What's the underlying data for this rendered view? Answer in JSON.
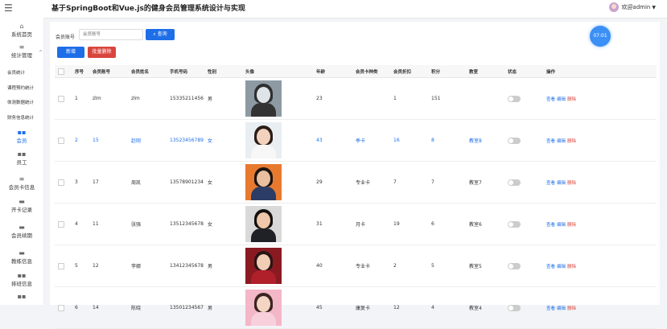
{
  "header": {
    "title": "基于SpringBoot和Vue.js的健身会员管理系统设计与实现",
    "user": "欢迎admin"
  },
  "sidebar": {
    "items": [
      {
        "label": "系统首页",
        "icon": "home-icon"
      },
      {
        "label": "统计管理",
        "icon": "menu-icon"
      },
      {
        "label": "会员",
        "icon": "grid-icon",
        "active": true
      },
      {
        "label": "员工",
        "icon": "grid-icon"
      },
      {
        "label": "会员卡信息",
        "icon": "menu-icon"
      },
      {
        "label": "开卡记录",
        "icon": "card-icon"
      },
      {
        "label": "会员续期",
        "icon": "card-icon"
      },
      {
        "label": "教练信息",
        "icon": "card-icon"
      },
      {
        "label": "排班信息",
        "icon": "grid-icon"
      }
    ],
    "sub_items": [
      "会员统计",
      "课程预约统计",
      "体测数据统计",
      "财务信息统计"
    ]
  },
  "search": {
    "label": "会员账号",
    "placeholder": "会员账号",
    "button": "查询"
  },
  "actions": {
    "add": "新增",
    "batch_delete": "批量删除"
  },
  "clock": "07:01",
  "table": {
    "columns": [
      "序号",
      "会员账号",
      "会员姓名",
      "手机号码",
      "性别",
      "头像",
      "年龄",
      "会员卡种类",
      "会员折扣",
      "积分",
      "教室",
      "状态",
      "操作"
    ],
    "row_actions": {
      "view": "查看",
      "edit": "编辑",
      "delete": "删除"
    },
    "rows": [
      {
        "no": "1",
        "account": "zlm",
        "name": "zlm",
        "phone": "15335211456",
        "gender": "男",
        "age": "23",
        "card": "",
        "discount": "1",
        "points": "151",
        "room": "",
        "photo": "cartoon"
      },
      {
        "no": "2",
        "account": "15",
        "name": "赵刚",
        "phone": "13523456789",
        "gender": "女",
        "age": "43",
        "card": "季卡",
        "discount": "16",
        "points": "8",
        "room": "教室8",
        "photo": "woman-white",
        "highlight": true
      },
      {
        "no": "3",
        "account": "17",
        "name": "周凯",
        "phone": "13578901234",
        "gender": "女",
        "age": "29",
        "card": "专业卡",
        "discount": "7",
        "points": "7",
        "room": "教室7",
        "photo": "man-orange"
      },
      {
        "no": "4",
        "account": "11",
        "name": "张强",
        "phone": "13512345678",
        "gender": "女",
        "age": "31",
        "card": "月卡",
        "discount": "19",
        "points": "6",
        "room": "教室6",
        "photo": "man-suit"
      },
      {
        "no": "5",
        "account": "12",
        "name": "李娜",
        "phone": "13412345678",
        "gender": "男",
        "age": "40",
        "card": "专业卡",
        "discount": "2",
        "points": "5",
        "room": "教室5",
        "photo": "woman-red"
      },
      {
        "no": "6",
        "account": "14",
        "name": "陈晓",
        "phone": "13501234567",
        "gender": "男",
        "age": "45",
        "card": "康复卡",
        "discount": "12",
        "points": "4",
        "room": "教室4",
        "photo": "woman-pink"
      }
    ]
  },
  "colors": {
    "primary": "#1e6ee8",
    "danger": "#d9453d"
  }
}
